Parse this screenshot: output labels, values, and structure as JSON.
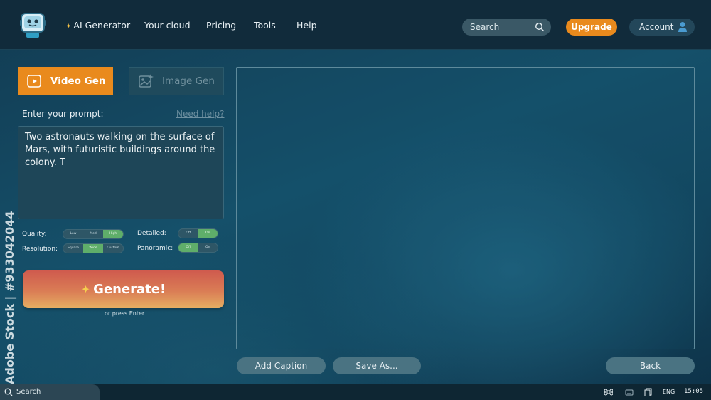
{
  "nav": {
    "items": [
      "AI Generator",
      "Your cloud",
      "Pricing",
      "Tools",
      "Help"
    ],
    "search_label": "Search",
    "upgrade_label": "Upgrade",
    "account_label": "Account"
  },
  "modes": {
    "video_label": "Video Gen",
    "image_label": "Image Gen",
    "active": "Video Gen"
  },
  "prompt": {
    "label": "Enter your prompt:",
    "help_link": "Need help?",
    "value": "Two astronauts walking on the surface of Mars, with futuristic buildings around the colony. T"
  },
  "options": {
    "quality": {
      "label": "Quality:",
      "choices": [
        "Low",
        "Med",
        "High"
      ],
      "selected": "High"
    },
    "resolution": {
      "label": "Resolution:",
      "choices": [
        "Square",
        "Wide",
        "Custom"
      ],
      "selected": "Wide"
    },
    "detailed": {
      "label": "Detailed:",
      "choices": [
        "Off",
        "On"
      ],
      "selected": "On"
    },
    "panoramic": {
      "label": "Panoramic:",
      "choices": [
        "Off",
        "On"
      ],
      "selected": "Off"
    }
  },
  "generate": {
    "label": "Generate!",
    "hint": "or press Enter"
  },
  "actions": {
    "add_caption": "Add Caption",
    "save_as": "Save As...",
    "back": "Back"
  },
  "watermark": "Adobe Stock | #933042044",
  "taskbar": {
    "search_label": "Search",
    "language": "ENG",
    "time": "15:05"
  },
  "colors": {
    "accent": "#e98a1d",
    "toggle_on": "#5fae6a",
    "topbar": "#112b3b"
  }
}
